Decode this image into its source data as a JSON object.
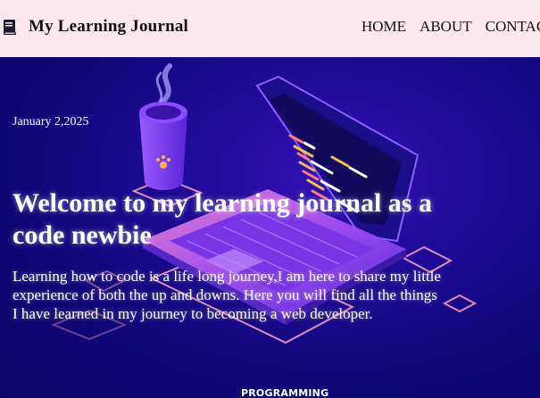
{
  "header": {
    "brand": "My Learning Journal",
    "logo_icon": "book-icon",
    "nav": [
      {
        "label": "HOME"
      },
      {
        "label": "ABOUT"
      },
      {
        "label": "CONTACT"
      }
    ]
  },
  "hero": {
    "date": "January 2,2025",
    "title": "Welcome to my learning journal as a code newbie",
    "description": "Learning how to code is a life long journey,I am here to share my little experience of both the up and downs. Here you will find all the things I have learned in my journey to becoming a web developer.",
    "category": "PROGRAMMING",
    "illustration": "laptop-and-coffee-illustration"
  },
  "colors": {
    "header_bg": "#fde7ef",
    "hero_bg": "#11077a",
    "accent": "#7b2cf0"
  }
}
